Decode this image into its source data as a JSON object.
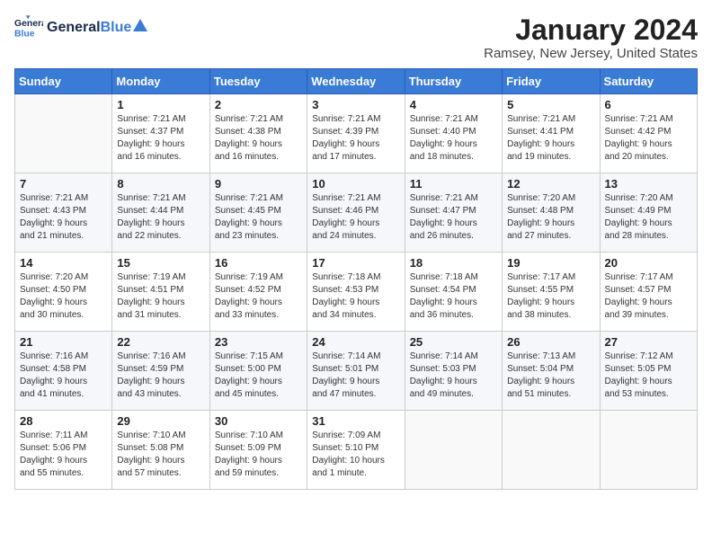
{
  "logo": {
    "text_general": "General",
    "text_blue": "Blue"
  },
  "title": "January 2024",
  "subtitle": "Ramsey, New Jersey, United States",
  "headers": [
    "Sunday",
    "Monday",
    "Tuesday",
    "Wednesday",
    "Thursday",
    "Friday",
    "Saturday"
  ],
  "weeks": [
    [
      {
        "num": "",
        "info": ""
      },
      {
        "num": "1",
        "info": "Sunrise: 7:21 AM\nSunset: 4:37 PM\nDaylight: 9 hours\nand 16 minutes."
      },
      {
        "num": "2",
        "info": "Sunrise: 7:21 AM\nSunset: 4:38 PM\nDaylight: 9 hours\nand 16 minutes."
      },
      {
        "num": "3",
        "info": "Sunrise: 7:21 AM\nSunset: 4:39 PM\nDaylight: 9 hours\nand 17 minutes."
      },
      {
        "num": "4",
        "info": "Sunrise: 7:21 AM\nSunset: 4:40 PM\nDaylight: 9 hours\nand 18 minutes."
      },
      {
        "num": "5",
        "info": "Sunrise: 7:21 AM\nSunset: 4:41 PM\nDaylight: 9 hours\nand 19 minutes."
      },
      {
        "num": "6",
        "info": "Sunrise: 7:21 AM\nSunset: 4:42 PM\nDaylight: 9 hours\nand 20 minutes."
      }
    ],
    [
      {
        "num": "7",
        "info": "Sunrise: 7:21 AM\nSunset: 4:43 PM\nDaylight: 9 hours\nand 21 minutes."
      },
      {
        "num": "8",
        "info": "Sunrise: 7:21 AM\nSunset: 4:44 PM\nDaylight: 9 hours\nand 22 minutes."
      },
      {
        "num": "9",
        "info": "Sunrise: 7:21 AM\nSunset: 4:45 PM\nDaylight: 9 hours\nand 23 minutes."
      },
      {
        "num": "10",
        "info": "Sunrise: 7:21 AM\nSunset: 4:46 PM\nDaylight: 9 hours\nand 24 minutes."
      },
      {
        "num": "11",
        "info": "Sunrise: 7:21 AM\nSunset: 4:47 PM\nDaylight: 9 hours\nand 26 minutes."
      },
      {
        "num": "12",
        "info": "Sunrise: 7:20 AM\nSunset: 4:48 PM\nDaylight: 9 hours\nand 27 minutes."
      },
      {
        "num": "13",
        "info": "Sunrise: 7:20 AM\nSunset: 4:49 PM\nDaylight: 9 hours\nand 28 minutes."
      }
    ],
    [
      {
        "num": "14",
        "info": "Sunrise: 7:20 AM\nSunset: 4:50 PM\nDaylight: 9 hours\nand 30 minutes."
      },
      {
        "num": "15",
        "info": "Sunrise: 7:19 AM\nSunset: 4:51 PM\nDaylight: 9 hours\nand 31 minutes."
      },
      {
        "num": "16",
        "info": "Sunrise: 7:19 AM\nSunset: 4:52 PM\nDaylight: 9 hours\nand 33 minutes."
      },
      {
        "num": "17",
        "info": "Sunrise: 7:18 AM\nSunset: 4:53 PM\nDaylight: 9 hours\nand 34 minutes."
      },
      {
        "num": "18",
        "info": "Sunrise: 7:18 AM\nSunset: 4:54 PM\nDaylight: 9 hours\nand 36 minutes."
      },
      {
        "num": "19",
        "info": "Sunrise: 7:17 AM\nSunset: 4:55 PM\nDaylight: 9 hours\nand 38 minutes."
      },
      {
        "num": "20",
        "info": "Sunrise: 7:17 AM\nSunset: 4:57 PM\nDaylight: 9 hours\nand 39 minutes."
      }
    ],
    [
      {
        "num": "21",
        "info": "Sunrise: 7:16 AM\nSunset: 4:58 PM\nDaylight: 9 hours\nand 41 minutes."
      },
      {
        "num": "22",
        "info": "Sunrise: 7:16 AM\nSunset: 4:59 PM\nDaylight: 9 hours\nand 43 minutes."
      },
      {
        "num": "23",
        "info": "Sunrise: 7:15 AM\nSunset: 5:00 PM\nDaylight: 9 hours\nand 45 minutes."
      },
      {
        "num": "24",
        "info": "Sunrise: 7:14 AM\nSunset: 5:01 PM\nDaylight: 9 hours\nand 47 minutes."
      },
      {
        "num": "25",
        "info": "Sunrise: 7:14 AM\nSunset: 5:03 PM\nDaylight: 9 hours\nand 49 minutes."
      },
      {
        "num": "26",
        "info": "Sunrise: 7:13 AM\nSunset: 5:04 PM\nDaylight: 9 hours\nand 51 minutes."
      },
      {
        "num": "27",
        "info": "Sunrise: 7:12 AM\nSunset: 5:05 PM\nDaylight: 9 hours\nand 53 minutes."
      }
    ],
    [
      {
        "num": "28",
        "info": "Sunrise: 7:11 AM\nSunset: 5:06 PM\nDaylight: 9 hours\nand 55 minutes."
      },
      {
        "num": "29",
        "info": "Sunrise: 7:10 AM\nSunset: 5:08 PM\nDaylight: 9 hours\nand 57 minutes."
      },
      {
        "num": "30",
        "info": "Sunrise: 7:10 AM\nSunset: 5:09 PM\nDaylight: 9 hours\nand 59 minutes."
      },
      {
        "num": "31",
        "info": "Sunrise: 7:09 AM\nSunset: 5:10 PM\nDaylight: 10 hours\nand 1 minute."
      },
      {
        "num": "",
        "info": ""
      },
      {
        "num": "",
        "info": ""
      },
      {
        "num": "",
        "info": ""
      }
    ]
  ]
}
